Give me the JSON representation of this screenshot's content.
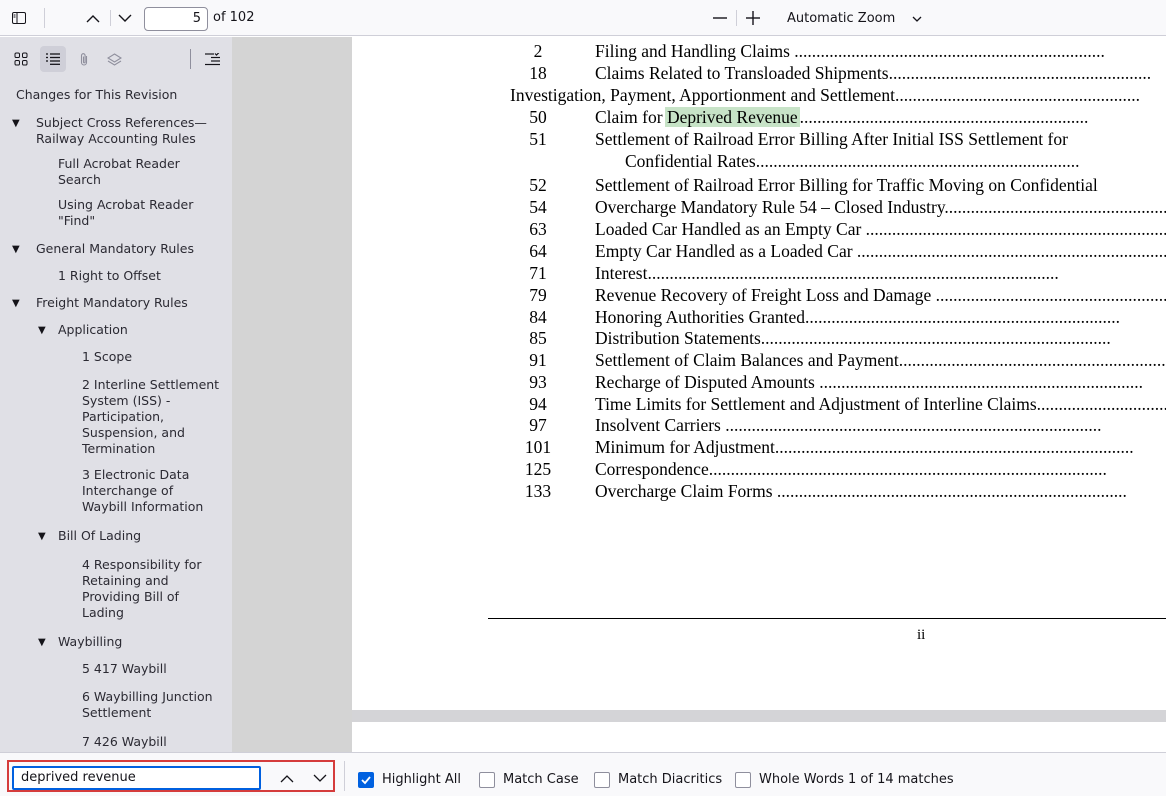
{
  "toolbar": {
    "sidebar_toggle_icon": "sidebar-toggle-icon",
    "page_number": "5",
    "page_count": "of 102",
    "zoom_out": "—",
    "zoom_in": "+",
    "zoom_value": "Automatic Zoom"
  },
  "sidebar": {
    "outline": [
      {
        "label": "Changes for This Revision"
      },
      {
        "label": "Subject Cross References—"
      },
      {
        "label": "Railway Accounting Rules"
      },
      {
        "label": "Full Acrobat Reader"
      },
      {
        "label": "Search"
      },
      {
        "label": "Using Acrobat Reader"
      },
      {
        "label": "\"Find\""
      },
      {
        "label": "General Mandatory Rules"
      },
      {
        "label": "1 Right to Offset"
      },
      {
        "label": "Freight Mandatory Rules"
      },
      {
        "label": "Application"
      },
      {
        "label": "1 Scope"
      },
      {
        "label": "2 Interline Settlement"
      },
      {
        "label": "System (ISS) -"
      },
      {
        "label": "Participation,"
      },
      {
        "label": "Suspension, and"
      },
      {
        "label": "Termination"
      },
      {
        "label": "3 Electronic Data"
      },
      {
        "label": "Interchange of"
      },
      {
        "label": "Waybill Information"
      },
      {
        "label": "Bill Of Lading"
      },
      {
        "label": "4 Responsibility for"
      },
      {
        "label": "Retaining and"
      },
      {
        "label": "Providing Bill of"
      },
      {
        "label": "Lading"
      },
      {
        "label": "Waybilling"
      },
      {
        "label": "5 417 Waybill"
      },
      {
        "label": "6 Waybilling Junction"
      },
      {
        "label": "Settlement"
      },
      {
        "label": "7 426 Waybill"
      }
    ]
  },
  "document": {
    "rows": [
      {
        "num": "2",
        "title": "Filing and Handling Claims ......................................................................."
      },
      {
        "num": "18",
        "title": "Claims Related to Transloaded Shipments............................................................"
      },
      {
        "num": "",
        "title": "Investigation, Payment, Apportionment and Settlement........................................................"
      },
      {
        "num": "50",
        "title_pre": "Claim for ",
        "title_hl": "Deprived Revenue",
        "title_post": ".................................................................."
      },
      {
        "num": "51",
        "title": "Settlement of Railroad Error Billing After Initial ISS Settlement for"
      },
      {
        "num": "",
        "title": "Confidential Rates.........................................................................."
      },
      {
        "num": "52",
        "title": "Settlement of Railroad Error Billing for Traffic Moving on Confidential"
      },
      {
        "num": "54",
        "title": "Overcharge Mandatory Rule 54 – Closed Industry..........................................................."
      },
      {
        "num": "63",
        "title": "Loaded Car Handled as an Empty Car ........................................................................"
      },
      {
        "num": "64",
        "title": "Empty Car Handled as a Loaded Car ........................................................................."
      },
      {
        "num": "71",
        "title": "Interest.............................................................................................."
      },
      {
        "num": "79",
        "title": "Revenue Recovery of Freight Loss and Damage ..................................................................."
      },
      {
        "num": "84",
        "title": "Honoring Authorities Granted........................................................................"
      },
      {
        "num": "85",
        "title": "Distribution Statements................................................................................"
      },
      {
        "num": "91",
        "title": "Settlement of Claim Balances and Payment.............................................................."
      },
      {
        "num": "93",
        "title": "Recharge of Disputed Amounts .........................................................................."
      },
      {
        "num": "94",
        "title": "Time Limits for Settlement and Adjustment of Interline Claims................................"
      },
      {
        "num": "97",
        "title": "Insolvent Carriers ......................................................................................"
      },
      {
        "num": "101",
        "title": "Minimum for Adjustment.................................................................................."
      },
      {
        "num": "125",
        "title": "Correspondence..........................................................................................."
      },
      {
        "num": "133",
        "title": "Overcharge Claim Forms ................................................................................"
      }
    ],
    "page_label": "ii"
  },
  "findbar": {
    "query": "deprived revenue",
    "highlight_all": "Highlight All",
    "match_case": "Match Case",
    "match_diacritics": "Match Diacritics",
    "whole_words": "Whole Words",
    "match_count": "1 of 14 matches"
  },
  "colors": {
    "accent": "#0061e0",
    "highlight": "#c7e3c7",
    "focus_outline": "#d53c3c"
  }
}
